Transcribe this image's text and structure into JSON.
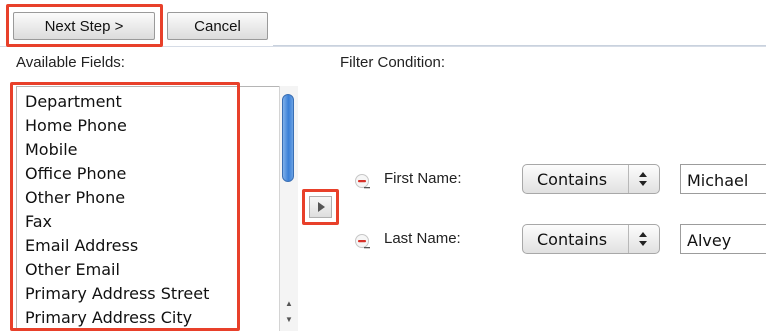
{
  "toolbar": {
    "next_label": "Next Step >",
    "cancel_label": "Cancel"
  },
  "available_fields": {
    "label": "Available Fields:",
    "items": [
      "Department",
      "Home Phone",
      "Mobile",
      "Office Phone",
      "Other Phone",
      "Fax",
      "Email Address",
      "Other Email",
      "Primary Address Street",
      "Primary Address City"
    ]
  },
  "filter": {
    "label": "Filter Condition:",
    "rows": [
      {
        "field": "First Name:",
        "operator": "Contains",
        "value": "Michael"
      },
      {
        "field": "Last Name:",
        "operator": "Contains",
        "value": "Alvey"
      }
    ]
  },
  "icons": {
    "remove": "minus-circle-icon",
    "move": "arrow-right-icon",
    "select_arrows": "up-down-arrows-icon"
  },
  "colors": {
    "highlight": "#e8402a",
    "scroll_thumb": "#3a7fd6"
  }
}
